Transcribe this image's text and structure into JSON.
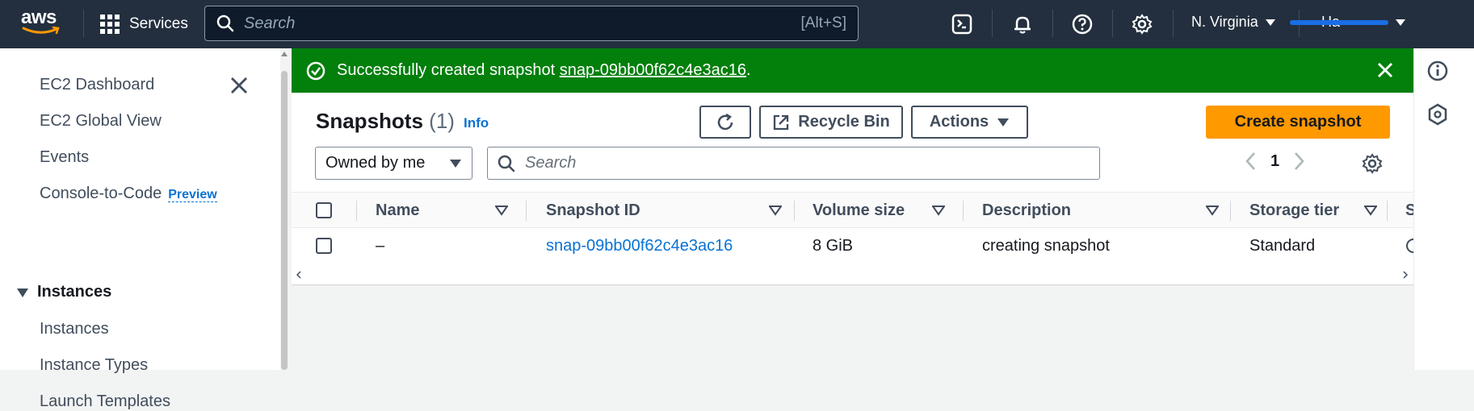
{
  "topbar": {
    "logo_text": "aws",
    "services_label": "Services",
    "search_placeholder": "Search",
    "search_shortcut": "[Alt+S]",
    "region_label": "N. Virginia",
    "user_label": "Ha"
  },
  "sidebar": {
    "items": [
      {
        "label": "EC2 Dashboard"
      },
      {
        "label": "EC2 Global View"
      },
      {
        "label": "Events"
      },
      {
        "label": "Console-to-Code",
        "badge": "Preview"
      }
    ],
    "section_title": "Instances",
    "section_items": [
      {
        "label": "Instances"
      },
      {
        "label": "Instance Types"
      },
      {
        "label": "Launch Templates"
      }
    ]
  },
  "flash": {
    "message_prefix": "Successfully created snapshot",
    "snapshot_link": "snap-09bb00f62c4e3ac16",
    "suffix": ".",
    "color": "#037f0c"
  },
  "header": {
    "title": "Snapshots",
    "count": "(1)",
    "info": "Info",
    "recycle_bin_label": "Recycle Bin",
    "actions_label": "Actions",
    "create_label": "Create snapshot",
    "owner_filter": "Owned by me",
    "search_placeholder": "Search",
    "page_number": "1"
  },
  "table": {
    "columns": [
      "Name",
      "Snapshot ID",
      "Volume size",
      "Description",
      "Storage tier",
      "S"
    ],
    "rows": [
      {
        "name": "–",
        "snapshot_id": "snap-09bb00f62c4e3ac16",
        "volume_size": "8 GiB",
        "description": "creating snapshot",
        "storage_tier": "Standard"
      }
    ]
  },
  "colors": {
    "nav_bg": "#232f3e",
    "primary_button": "#ff9900",
    "link": "#0972d3"
  }
}
